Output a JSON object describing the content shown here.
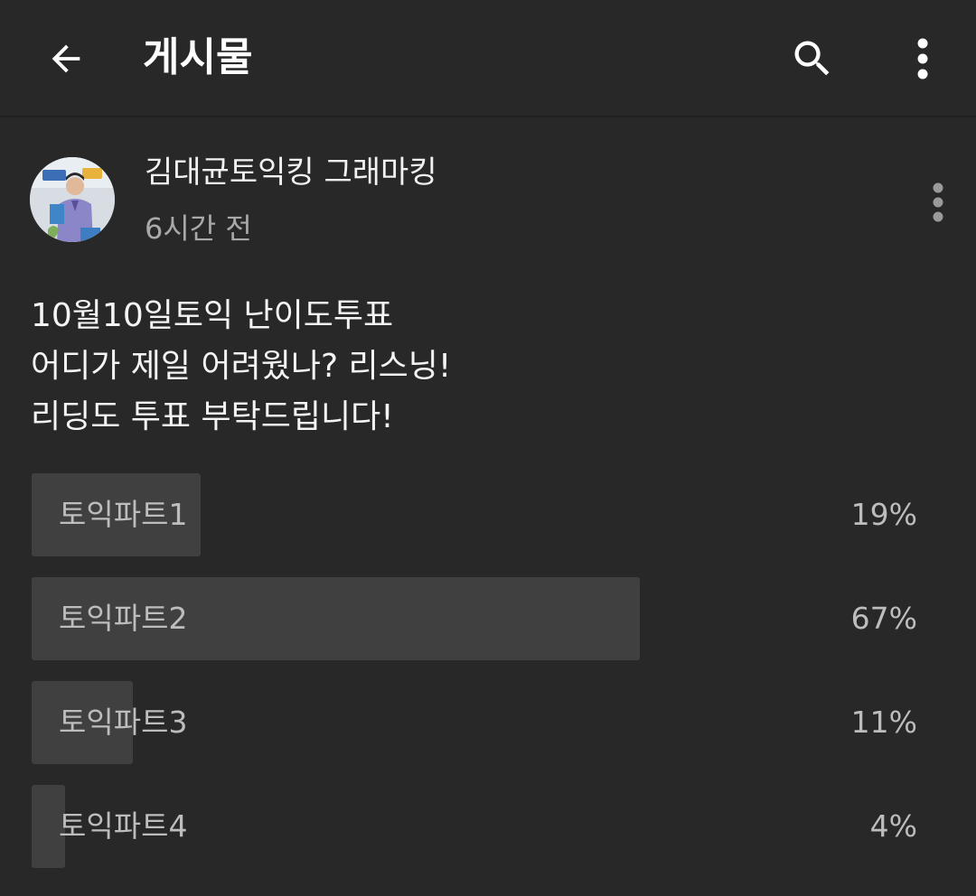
{
  "header": {
    "title": "게시물",
    "back_icon": "arrow-left-icon",
    "search_icon": "search-icon",
    "menu_icon": "more-vertical-icon"
  },
  "post": {
    "author": "김대균토익킹 그래마킹",
    "time": "6시간 전",
    "body_lines": [
      "10월10일토익 난이도투표",
      "어디가 제일 어려웠나? 리스닝!",
      "리딩도 투표 부탁드립니다!"
    ],
    "menu_icon": "more-vertical-icon"
  },
  "poll": {
    "options": [
      {
        "label": "토익파트1",
        "percent_text": "19%",
        "fraction": 0.187
      },
      {
        "label": "토익파트2",
        "percent_text": "67%",
        "fraction": 0.673
      },
      {
        "label": "토익파트3",
        "percent_text": "11%",
        "fraction": 0.112
      },
      {
        "label": "토익파트4",
        "percent_text": "4%",
        "fraction": 0.037
      }
    ]
  },
  "colors": {
    "background": "#282828",
    "bar": "#404040",
    "text_primary": "#ffffff",
    "text_secondary": "#a9a9a9"
  }
}
